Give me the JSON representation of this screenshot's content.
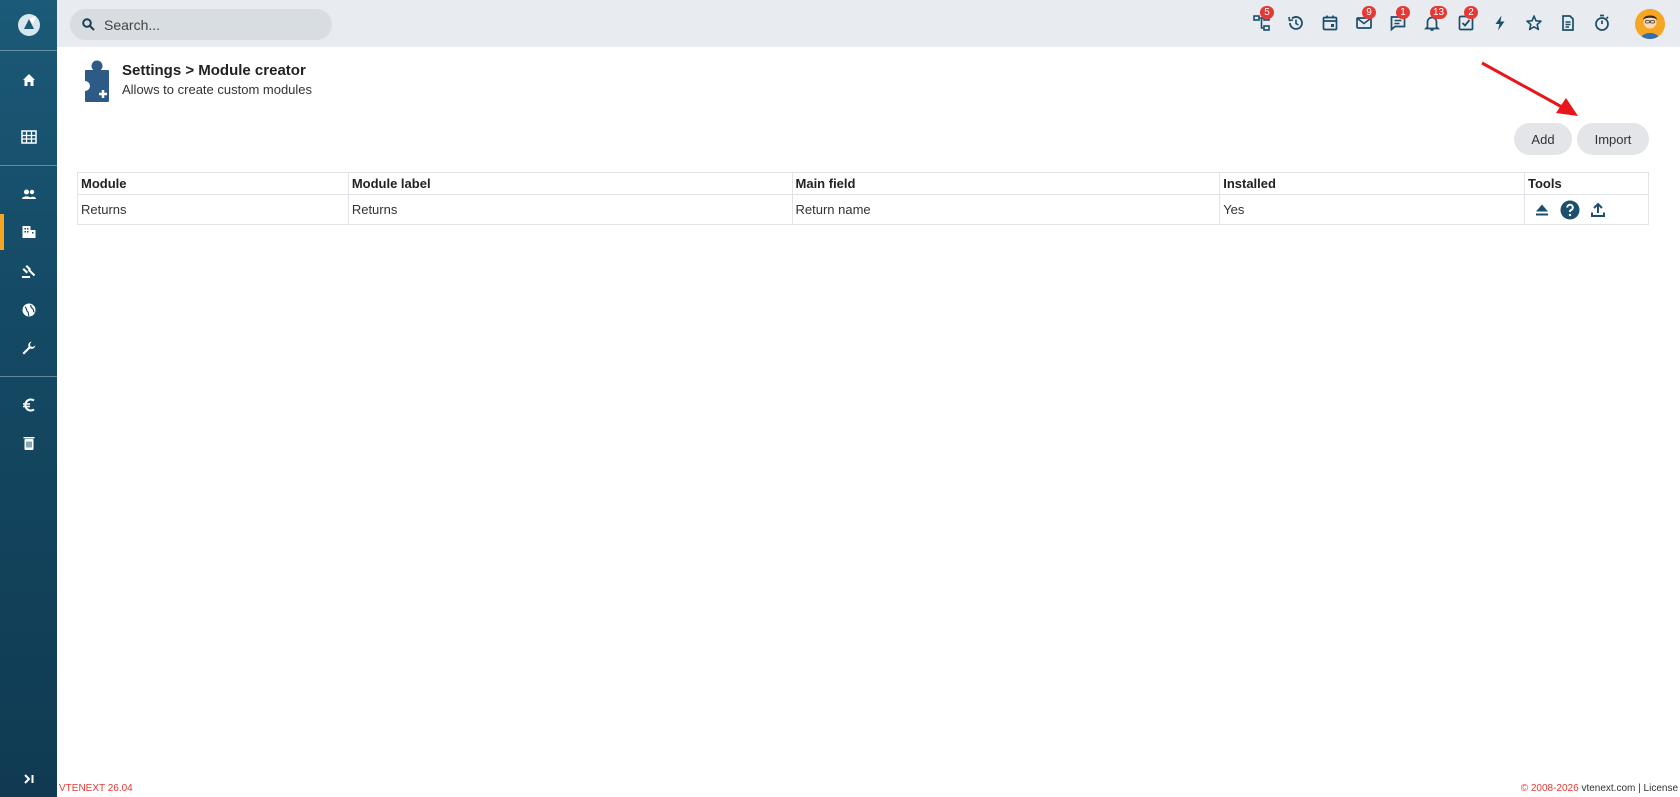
{
  "search": {
    "placeholder": "Search..."
  },
  "topbar": {
    "badges": {
      "processes": "5",
      "mail": "9",
      "chat": "1",
      "notifications": "13",
      "tasks": "2"
    }
  },
  "header": {
    "title": "Settings > Module creator",
    "subtitle": "Allows to create custom modules"
  },
  "actions": {
    "add_label": "Add",
    "import_label": "Import"
  },
  "table": {
    "headers": [
      "Module",
      "Module label",
      "Main field",
      "Installed",
      "Tools"
    ],
    "rows": [
      {
        "module": "Returns",
        "label": "Returns",
        "main_field": "Return name",
        "installed": "Yes"
      }
    ]
  },
  "footer": {
    "version": "VTENEXT 26.04",
    "copyright": "© 2008-2026",
    "site": "vtenext.com",
    "separator": "|",
    "license": "License"
  },
  "colors": {
    "sidebar": "#154b66",
    "accent": "#f5a623",
    "badge": "#e53935",
    "icon": "#1b4f6b",
    "arrow": "#e8151b"
  }
}
